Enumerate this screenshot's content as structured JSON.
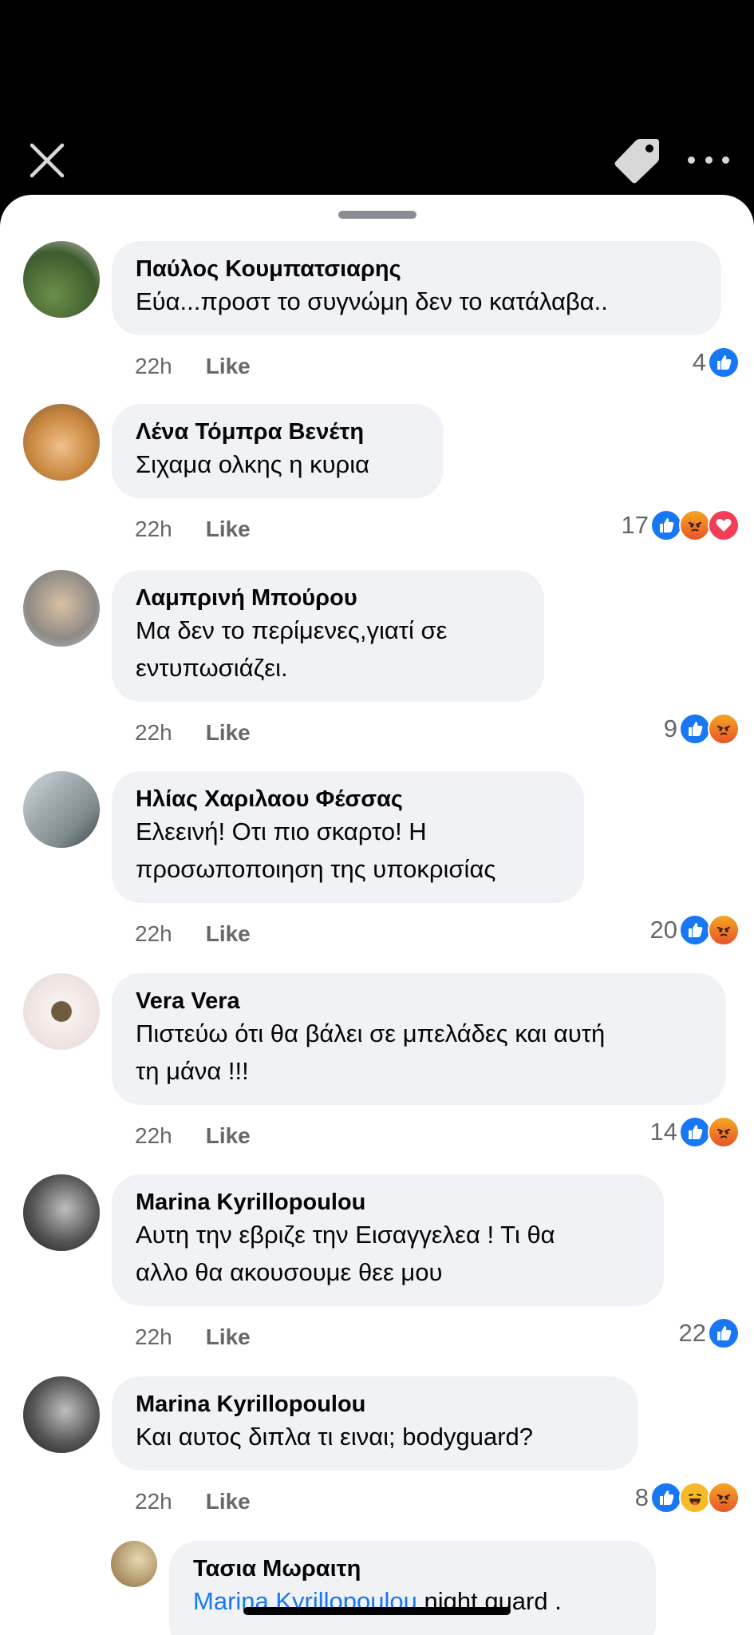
{
  "toolbar": {
    "close_icon": "close-icon",
    "tag_icon": "tag-icon",
    "more_icon": "more-icon"
  },
  "colors": {
    "like": "#1877f2",
    "bubble": "#f0f2f5",
    "meta": "#65676b",
    "mention": "#1877f2"
  },
  "comments": [
    {
      "author": "Παύλος Κουμπατσιαρης",
      "lines": [
        "Εύα...προστ το συγνώμη δεν το κατάλαβα.."
      ],
      "time": "22h",
      "like_label": "Like",
      "reaction_count": "4",
      "reactions": [
        "like"
      ]
    },
    {
      "author": "Λένα Τόμπρα Βενέτη",
      "lines": [
        "Σιχαμα ολκης η κυρια"
      ],
      "time": "22h",
      "like_label": "Like",
      "reaction_count": "17",
      "reactions": [
        "like",
        "angry",
        "love"
      ]
    },
    {
      "author": "Λαμπρινή Μπούρου",
      "lines": [
        "Μα δεν το  περίμενες,γιατί σε",
        "εντυπωσιάζει."
      ],
      "time": "22h",
      "like_label": "Like",
      "reaction_count": "9",
      "reactions": [
        "like",
        "angry"
      ]
    },
    {
      "author": "Ηλίας Χαριλαου Φέσσας",
      "lines": [
        "Ελεεινή! Οτι πιο σκαρτο! Η",
        "προσωποποιηση της υποκρισίας"
      ],
      "time": "22h",
      "like_label": "Like",
      "reaction_count": "20",
      "reactions": [
        "like",
        "angry"
      ]
    },
    {
      "author": "Vera Vera",
      "lines": [
        "Πιστεύω ότι θα βάλει σε μπελάδες και αυτή",
        "τη μάνα !!!"
      ],
      "time": "22h",
      "like_label": "Like",
      "reaction_count": "14",
      "reactions": [
        "like",
        "angry"
      ]
    },
    {
      "author": "Marina Kyrillopoulou",
      "lines": [
        "Αυτη την εβριζε την Εισαγγελεα ! Τι θα",
        "αλλο θα ακουσουμε θεε μου"
      ],
      "time": "22h",
      "like_label": "Like",
      "reaction_count": "22",
      "reactions": [
        "like"
      ]
    },
    {
      "author": "Marina Kyrillopoulou",
      "lines": [
        "Και αυτος διπλα τι ειναι; bodyguard?"
      ],
      "time": "22h",
      "like_label": "Like",
      "reaction_count": "8",
      "reactions": [
        "like",
        "haha",
        "angry"
      ]
    }
  ],
  "reply": {
    "author": "Τασια Μωραιτη",
    "mention": "Marina Kyrillopoulou",
    "text": " night guard ."
  }
}
